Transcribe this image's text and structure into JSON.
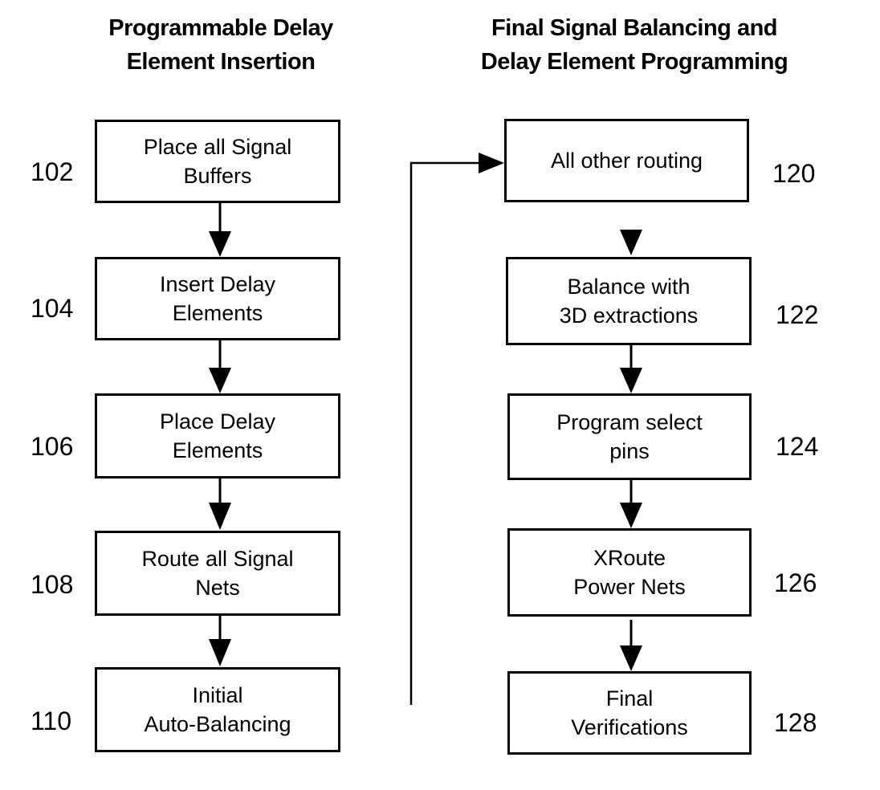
{
  "left_column": {
    "heading_line1": "Programmable Delay",
    "heading_line2": "Element Insertion",
    "steps": [
      {
        "ref": "102",
        "line1": "Place all Signal",
        "line2": "Buffers"
      },
      {
        "ref": "104",
        "line1": "Insert Delay",
        "line2": "Elements"
      },
      {
        "ref": "106",
        "line1": "Place Delay",
        "line2": "Elements"
      },
      {
        "ref": "108",
        "line1": "Route all Signal",
        "line2": "Nets"
      },
      {
        "ref": "110",
        "line1": "Initial",
        "line2": "Auto-Balancing"
      }
    ]
  },
  "right_column": {
    "heading_line1": "Final Signal Balancing and",
    "heading_line2": "Delay Element Programming",
    "steps": [
      {
        "ref": "120",
        "line1": "All other routing",
        "line2": ""
      },
      {
        "ref": "122",
        "line1": "Balance with",
        "line2": "3D extractions"
      },
      {
        "ref": "124",
        "line1": "Program select",
        "line2": "pins"
      },
      {
        "ref": "126",
        "line1": "XRoute",
        "line2": "Power Nets"
      },
      {
        "ref": "128",
        "line1": "Final",
        "line2": "Verifications"
      }
    ]
  }
}
